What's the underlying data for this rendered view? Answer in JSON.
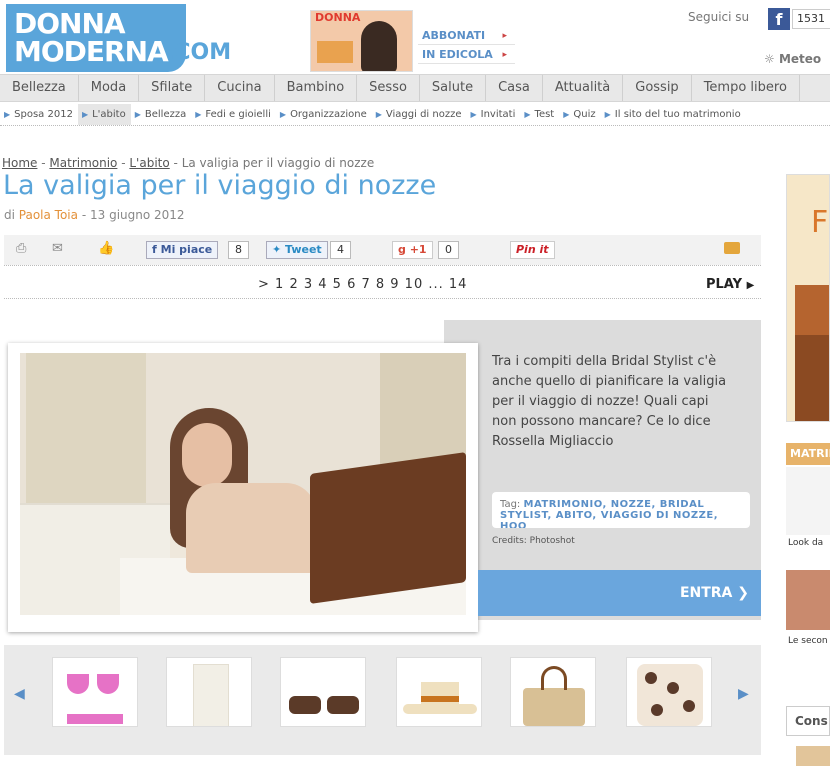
{
  "header": {
    "logo_line1": "DONNA",
    "logo_line2": "MODERNA",
    "logo_suffix": ".COM",
    "magazine_title": "DONNA",
    "subscribe": [
      {
        "label": "ABBONATI",
        "arrow": "▸"
      },
      {
        "label": "IN EDICOLA",
        "arrow": "▸"
      }
    ],
    "follow_label": "Seguici su",
    "fb_icon": "f",
    "fb_count": "1531",
    "meteo_label": "Meteo",
    "meteo_icon": "sun-cloud-icon"
  },
  "nav": [
    "Bellezza",
    "Moda",
    "Sfilate",
    "Cucina",
    "Bambino",
    "Sesso",
    "Salute",
    "Casa",
    "Attualità",
    "Gossip",
    "Tempo libero"
  ],
  "subnav": {
    "items": [
      "Sposa 2012",
      "L'abito",
      "Bellezza",
      "Fedi e gioielli",
      "Organizzazione",
      "Viaggi di nozze",
      "Invitati",
      "Test",
      "Quiz",
      "Il sito del tuo matrimonio"
    ],
    "active": "L'abito"
  },
  "breadcrumb": {
    "items": [
      "Home",
      "Matrimonio",
      "L'abito"
    ],
    "separator": " - ",
    "current": "La valigia per il viaggio di nozze"
  },
  "article": {
    "title": "La valigia per il viaggio di nozze",
    "by_prefix": "di",
    "author": "Paola Toia",
    "date_sep": "-",
    "date": "13 giugno 2012"
  },
  "share": {
    "facebook_label": "Mi piace",
    "facebook_count": "8",
    "twitter_label": "Tweet",
    "twitter_count": "4",
    "gplus_label": "+1",
    "gplus_count": "0",
    "pinterest_label": "Pin it"
  },
  "pager": {
    "prefix": ">",
    "pages": "1 2 3 4 5 6 7 8 9 10",
    "ellipsis": "...",
    "last": "14",
    "play": "PLAY"
  },
  "gallery": {
    "description": "Tra i compiti della Bridal Stylist c'è anche quello di pianificare la valigia per il viaggio di nozze! Quali capi non possono mancare? Ce lo dice Rossella Migliaccio",
    "tags_label": "Tag:",
    "tags": "MATRIMONIO, NOZZE, BRIDAL STYLIST, ABITO, VIAGGIO DI NOZZE, HOO",
    "credits": "Credits: Photoshot",
    "enter_label": "ENTRA"
  },
  "thumbnails": [
    {
      "name": "pink-bikini"
    },
    {
      "name": "white-dress"
    },
    {
      "name": "sunglasses"
    },
    {
      "name": "straw-hat"
    },
    {
      "name": "straw-bag"
    },
    {
      "name": "printed-blouse"
    }
  ],
  "right_column": {
    "ad_letter": "F",
    "section_label": "MATRIMONIO",
    "caption1": "Look da",
    "caption2": "Le secon",
    "box_label": "Cons"
  }
}
